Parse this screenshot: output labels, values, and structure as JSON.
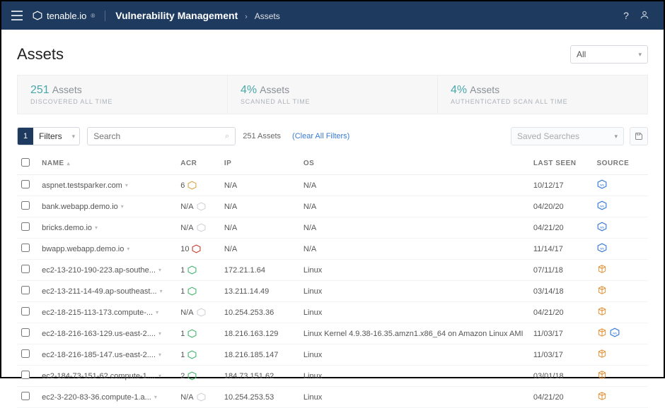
{
  "brand": "tenable.io",
  "breadcrumb": {
    "section": "Vulnerability Management",
    "page": "Assets"
  },
  "title": "Assets",
  "scope": {
    "selected": "All"
  },
  "stats": [
    {
      "num": "251",
      "label": "Assets",
      "sub": "DISCOVERED ALL TIME"
    },
    {
      "num": "4%",
      "label": "Assets",
      "sub": "SCANNED ALL TIME"
    },
    {
      "num": "4%",
      "label": "Assets",
      "sub": "AUTHENTICATED SCAN ALL TIME"
    }
  ],
  "filters": {
    "count": "1",
    "label": "Filters"
  },
  "search": {
    "placeholder": "Search"
  },
  "results": {
    "count": "251 Assets",
    "clear": "(Clear All Filters)"
  },
  "saved_searches": {
    "placeholder": "Saved Searches"
  },
  "columns": {
    "name": "NAME",
    "acr": "ACR",
    "ip": "IP",
    "os": "OS",
    "last": "LAST SEEN",
    "source": "SOURCE"
  },
  "rows": [
    {
      "name": "aspnet.testsparker.com",
      "acr": "6",
      "acr_color": "#d9a441",
      "ip": "N/A",
      "os": "N/A",
      "last": "10/12/17",
      "src": [
        "ws"
      ]
    },
    {
      "name": "bank.webapp.demo.io",
      "acr": "N/A",
      "acr_color": "#cfd3d8",
      "ip": "N/A",
      "os": "N/A",
      "last": "04/20/20",
      "src": [
        "ws"
      ]
    },
    {
      "name": "bricks.demo.io",
      "acr": "N/A",
      "acr_color": "#cfd3d8",
      "ip": "N/A",
      "os": "N/A",
      "last": "04/21/20",
      "src": [
        "ws"
      ]
    },
    {
      "name": "bwapp.webapp.demo.io",
      "acr": "10",
      "acr_color": "#c0392b",
      "ip": "N/A",
      "os": "N/A",
      "last": "11/14/17",
      "src": [
        "ws"
      ]
    },
    {
      "name": "ec2-13-210-190-223.ap-southe...",
      "acr": "1",
      "acr_color": "#40b36b",
      "ip": "172.21.1.64",
      "os": "Linux",
      "last": "07/11/18",
      "src": [
        "aws"
      ]
    },
    {
      "name": "ec2-13-211-14-49.ap-southeast...",
      "acr": "1",
      "acr_color": "#40b36b",
      "ip": "13.211.14.49",
      "os": "Linux",
      "last": "03/14/18",
      "src": [
        "aws"
      ]
    },
    {
      "name": "ec2-18-215-113-173.compute-...",
      "acr": "N/A",
      "acr_color": "#cfd3d8",
      "ip": "10.254.253.36",
      "os": "Linux",
      "last": "04/21/20",
      "src": [
        "aws"
      ]
    },
    {
      "name": "ec2-18-216-163-129.us-east-2....",
      "acr": "1",
      "acr_color": "#40b36b",
      "ip": "18.216.163.129",
      "os": "Linux Kernel 4.9.38-16.35.amzn1.x86_64 on Amazon Linux AMI",
      "last": "11/03/17",
      "src": [
        "aws",
        "ws"
      ]
    },
    {
      "name": "ec2-18-216-185-147.us-east-2....",
      "acr": "1",
      "acr_color": "#40b36b",
      "ip": "18.216.185.147",
      "os": "Linux",
      "last": "11/03/17",
      "src": [
        "aws"
      ]
    },
    {
      "name": "ec2-184-73-151-62.compute-1....",
      "acr": "2",
      "acr_color": "#40b36b",
      "ip": "184.73.151.62",
      "os": "Linux",
      "last": "03/01/18",
      "src": [
        "aws"
      ]
    },
    {
      "name": "ec2-3-220-83-36.compute-1.a...",
      "acr": "N/A",
      "acr_color": "#cfd3d8",
      "ip": "10.254.253.53",
      "os": "Linux",
      "last": "04/21/20",
      "src": [
        "aws"
      ]
    }
  ]
}
